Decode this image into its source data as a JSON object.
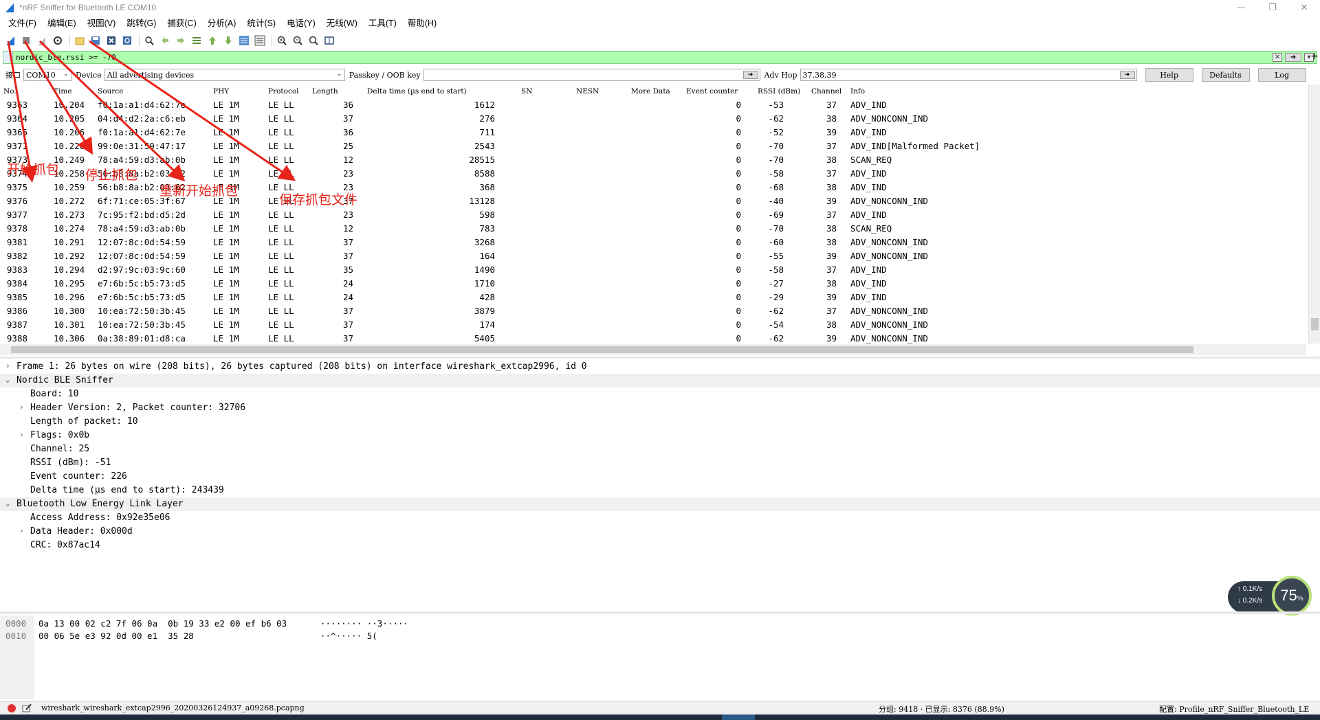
{
  "window": {
    "title": "*nRF Sniffer for Bluetooth LE COM10",
    "controls": [
      "—",
      "❐",
      "✕"
    ]
  },
  "menu": [
    "文件(F)",
    "编辑(E)",
    "视图(V)",
    "跳转(G)",
    "捕获(C)",
    "分析(A)",
    "统计(S)",
    "电话(Y)",
    "无线(W)",
    "工具(T)",
    "帮助(H)"
  ],
  "filter": {
    "text": "nordic_ble.rssi >= -70",
    "plus": "+"
  },
  "interface_bar": {
    "interface_label": "接口",
    "interface_value": "COM10",
    "device_label": "Device",
    "device_value": "All advertising devices",
    "passkey_label": "Passkey / OOB key",
    "passkey_value": "",
    "adv_hop_label": "Adv Hop",
    "adv_hop_value": "37,38,39",
    "help_label": "Help",
    "defaults_label": "Defaults",
    "log_label": "Log"
  },
  "columns": [
    "No.",
    "Time",
    "Source",
    "PHY",
    "Protocol",
    "Length",
    "Delta time (µs end to start)",
    "SN",
    "NESN",
    "More Data",
    "Event counter",
    "RSSI (dBm)",
    "Channel",
    "Info"
  ],
  "packets": [
    {
      "no": "9363",
      "time": "10.204",
      "source": "f0:1a:a1:d4:62:7e",
      "phy": "LE 1M",
      "proto": "LE LL",
      "len": "36",
      "delta": "1612",
      "ev": "0",
      "rssi": "-53",
      "ch": "37",
      "info": "ADV_IND"
    },
    {
      "no": "9364",
      "time": "10.205",
      "source": "04:d4:d2:2a:c6:eb",
      "phy": "LE 1M",
      "proto": "LE LL",
      "len": "37",
      "delta": "276",
      "ev": "0",
      "rssi": "-62",
      "ch": "38",
      "info": "ADV_NONCONN_IND"
    },
    {
      "no": "9365",
      "time": "10.206",
      "source": "f0:1a:a1:d4:62:7e",
      "phy": "LE 1M",
      "proto": "LE LL",
      "len": "36",
      "delta": "711",
      "ev": "0",
      "rssi": "-52",
      "ch": "39",
      "info": "ADV_IND"
    },
    {
      "no": "9371",
      "time": "10.226",
      "source": "99:0e:31:59:47:17",
      "phy": "LE 1M",
      "proto": "LE LL",
      "len": "25",
      "delta": "2543",
      "ev": "0",
      "rssi": "-70",
      "ch": "37",
      "info": "ADV_IND[Malformed Packet]"
    },
    {
      "no": "9373",
      "time": "10.249",
      "source": "78:a4:59:d3:ab:0b",
      "phy": "LE 1M",
      "proto": "LE LL",
      "len": "12",
      "delta": "28515",
      "ev": "0",
      "rssi": "-70",
      "ch": "38",
      "info": "SCAN_REQ"
    },
    {
      "no": "9374",
      "time": "10.258",
      "source": "56:b8:8a:b2:03:62",
      "phy": "LE 1M",
      "proto": "LE LL",
      "len": "23",
      "delta": "8588",
      "ev": "0",
      "rssi": "-58",
      "ch": "37",
      "info": "ADV_IND"
    },
    {
      "no": "9375",
      "time": "10.259",
      "source": "56:b8:8a:b2:03:62",
      "phy": "LE 1M",
      "proto": "LE LL",
      "len": "23",
      "delta": "368",
      "ev": "0",
      "rssi": "-68",
      "ch": "38",
      "info": "ADV_IND"
    },
    {
      "no": "9376",
      "time": "10.272",
      "source": "6f:71:ce:05:3f:67",
      "phy": "LE 1M",
      "proto": "LE LL",
      "len": "37",
      "delta": "13128",
      "ev": "0",
      "rssi": "-40",
      "ch": "39",
      "info": "ADV_NONCONN_IND"
    },
    {
      "no": "9377",
      "time": "10.273",
      "source": "7c:95:f2:bd:d5:2d",
      "phy": "LE 1M",
      "proto": "LE LL",
      "len": "23",
      "delta": "598",
      "ev": "0",
      "rssi": "-69",
      "ch": "37",
      "info": "ADV_IND"
    },
    {
      "no": "9378",
      "time": "10.274",
      "source": "78:a4:59:d3:ab:0b",
      "phy": "LE 1M",
      "proto": "LE LL",
      "len": "12",
      "delta": "783",
      "ev": "0",
      "rssi": "-70",
      "ch": "38",
      "info": "SCAN_REQ"
    },
    {
      "no": "9381",
      "time": "10.291",
      "source": "12:07:8c:0d:54:59",
      "phy": "LE 1M",
      "proto": "LE LL",
      "len": "37",
      "delta": "3268",
      "ev": "0",
      "rssi": "-60",
      "ch": "38",
      "info": "ADV_NONCONN_IND"
    },
    {
      "no": "9382",
      "time": "10.292",
      "source": "12:07:8c:0d:54:59",
      "phy": "LE 1M",
      "proto": "LE LL",
      "len": "37",
      "delta": "164",
      "ev": "0",
      "rssi": "-55",
      "ch": "39",
      "info": "ADV_NONCONN_IND"
    },
    {
      "no": "9383",
      "time": "10.294",
      "source": "d2:97:9c:03:9c:60",
      "phy": "LE 1M",
      "proto": "LE LL",
      "len": "35",
      "delta": "1490",
      "ev": "0",
      "rssi": "-58",
      "ch": "37",
      "info": "ADV_IND"
    },
    {
      "no": "9384",
      "time": "10.295",
      "source": "e7:6b:5c:b5:73:d5",
      "phy": "LE 1M",
      "proto": "LE LL",
      "len": "24",
      "delta": "1710",
      "ev": "0",
      "rssi": "-27",
      "ch": "38",
      "info": "ADV_IND"
    },
    {
      "no": "9385",
      "time": "10.296",
      "source": "e7:6b:5c:b5:73:d5",
      "phy": "LE 1M",
      "proto": "LE LL",
      "len": "24",
      "delta": "428",
      "ev": "0",
      "rssi": "-29",
      "ch": "39",
      "info": "ADV_IND"
    },
    {
      "no": "9386",
      "time": "10.300",
      "source": "10:ea:72:50:3b:45",
      "phy": "LE 1M",
      "proto": "LE LL",
      "len": "37",
      "delta": "3879",
      "ev": "0",
      "rssi": "-62",
      "ch": "37",
      "info": "ADV_NONCONN_IND"
    },
    {
      "no": "9387",
      "time": "10.301",
      "source": "10:ea:72:50:3b:45",
      "phy": "LE 1M",
      "proto": "LE LL",
      "len": "37",
      "delta": "174",
      "ev": "0",
      "rssi": "-54",
      "ch": "38",
      "info": "ADV_NONCONN_IND"
    },
    {
      "no": "9388",
      "time": "10.306",
      "source": "0a:38:89:01:d8:ca",
      "phy": "LE 1M",
      "proto": "LE LL",
      "len": "37",
      "delta": "5405",
      "ev": "0",
      "rssi": "-62",
      "ch": "39",
      "info": "ADV_NONCONN_IND"
    }
  ],
  "details": [
    {
      "text": "Frame 1: 26 bytes on wire (208 bits), 26 bytes captured (208 bits) on interface wireshark_extcap2996, id 0",
      "arrow": "›"
    },
    {
      "text": "Nordic BLE Sniffer",
      "arrow": "⌄",
      "hl": true
    },
    {
      "text": "Board: 10"
    },
    {
      "text": "Header Version: 2, Packet counter: 32706",
      "arrow": "›"
    },
    {
      "text": "Length of packet: 10"
    },
    {
      "text": "Flags: 0x0b",
      "arrow": "›"
    },
    {
      "text": "Channel: 25"
    },
    {
      "text": "RSSI (dBm): -51"
    },
    {
      "text": "Event counter: 226"
    },
    {
      "text": "Delta time (µs end to start): 243439"
    },
    {
      "text": "Bluetooth Low Energy Link Layer",
      "arrow": "⌄",
      "hl": true
    },
    {
      "text": "Access Address: 0x92e35e06"
    },
    {
      "text": "Data Header: 0x000d",
      "arrow": "›"
    },
    {
      "text": "CRC: 0x87ac14"
    }
  ],
  "hex_dump": [
    {
      "offset": "0000",
      "bytes": "0a 13 00 02 c2 7f 06 0a  0b 19 33 e2 00 ef b6 03",
      "ascii": "········ ··3·····"
    },
    {
      "offset": "0010",
      "bytes": "00 06 5e e3 92 0d 00 e1  35 28",
      "ascii": "··^····· 5("
    }
  ],
  "net_widget": {
    "up": "↑ 0.1K/s",
    "down": "↓ 0.2K/s",
    "percent": "75",
    "percent_unit": "%"
  },
  "status": {
    "file": "wireshark_wireshark_extcap2996_20200326124937_a09268.pcapng",
    "packets": "分组: 9418 · 已显示: 8376 (88.9%)",
    "profile": "配置: Profile_nRF_Sniffer_Bluetooth_LE"
  },
  "annotations": [
    "开始抓包",
    "停止抓包",
    "重新开始抓包",
    "保存抓包文件"
  ],
  "colors": {
    "filter_bg": "#afffaf",
    "annotation": "#e8231a",
    "detail_highlight": "#eef0f2"
  }
}
